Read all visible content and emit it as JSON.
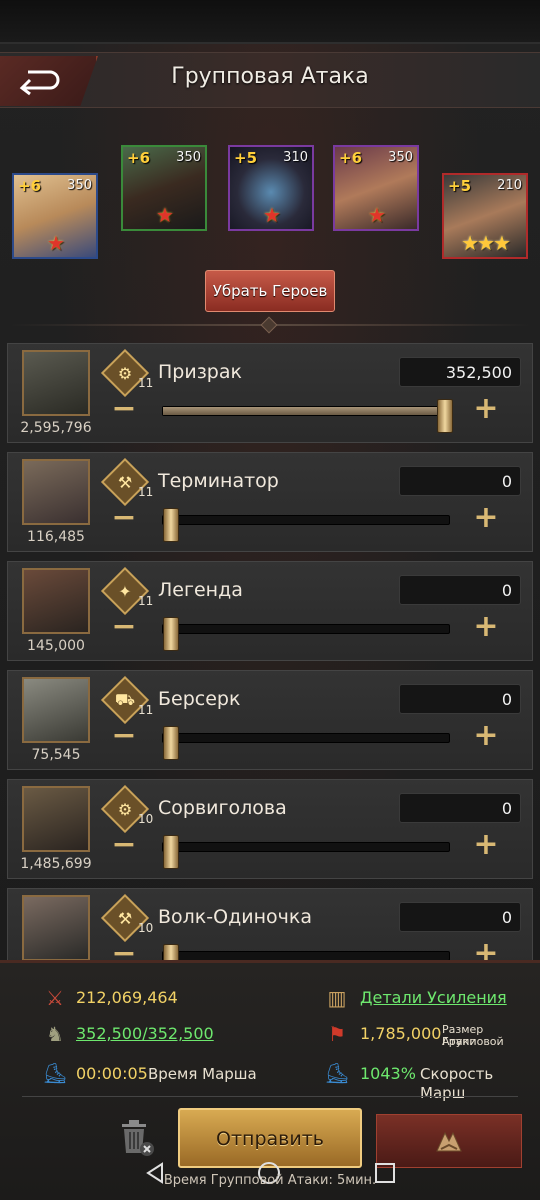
{
  "header": {
    "title": "Групповая Атака"
  },
  "heroes": [
    {
      "plus": "+6",
      "level": "350",
      "stars": "★",
      "border": "#2c4a8a"
    },
    {
      "plus": "+6",
      "level": "350",
      "stars": "★",
      "border": "#3a8a3a"
    },
    {
      "plus": "+5",
      "level": "310",
      "stars": "★",
      "border": "#7a3aa0"
    },
    {
      "plus": "+6",
      "level": "350",
      "stars": "★",
      "border": "#7a3aa0"
    },
    {
      "plus": "+5",
      "level": "210",
      "stars": "★★★",
      "border": "#b02a2a"
    }
  ],
  "remove_heroes_label": "Убрать Героев",
  "troops": [
    {
      "name": "Призрак",
      "tier": "11",
      "power": "2,595,796",
      "count": "352,500",
      "fill": 1.0,
      "type_icon": "motorcycle-icon"
    },
    {
      "name": "Терминатор",
      "tier": "11",
      "power": "116,485",
      "count": "0",
      "fill": 0.0,
      "type_icon": "axe-icon"
    },
    {
      "name": "Легенда",
      "tier": "11",
      "power": "145,000",
      "count": "0",
      "fill": 0.0,
      "type_icon": "rifle-icon"
    },
    {
      "name": "Берсерк",
      "tier": "11",
      "power": "75,545",
      "count": "0",
      "fill": 0.0,
      "type_icon": "car-icon"
    },
    {
      "name": "Сорвиголова",
      "tier": "10",
      "power": "1,485,699",
      "count": "0",
      "fill": 0.0,
      "type_icon": "motorcycle-icon"
    },
    {
      "name": "Волк-Одиночка",
      "tier": "10",
      "power": "",
      "count": "0",
      "fill": 0.0,
      "type_icon": "axe-icon"
    }
  ],
  "bottom": {
    "total_power": "212,069,464",
    "troops_count": "352,500/352,500",
    "march_time": "00:00:05",
    "march_time_label": "Время Марша",
    "boost_details": "Детали Усиления",
    "rally_size": "1,785,000",
    "rally_size_label_1": "Размер Групповой",
    "rally_size_label_2": "Атаки",
    "speed": "1043%",
    "speed_label": "Скорость Марш",
    "send_label": "Отправить",
    "rally_time_label": "Время Групповой Атаки: 5мин."
  }
}
